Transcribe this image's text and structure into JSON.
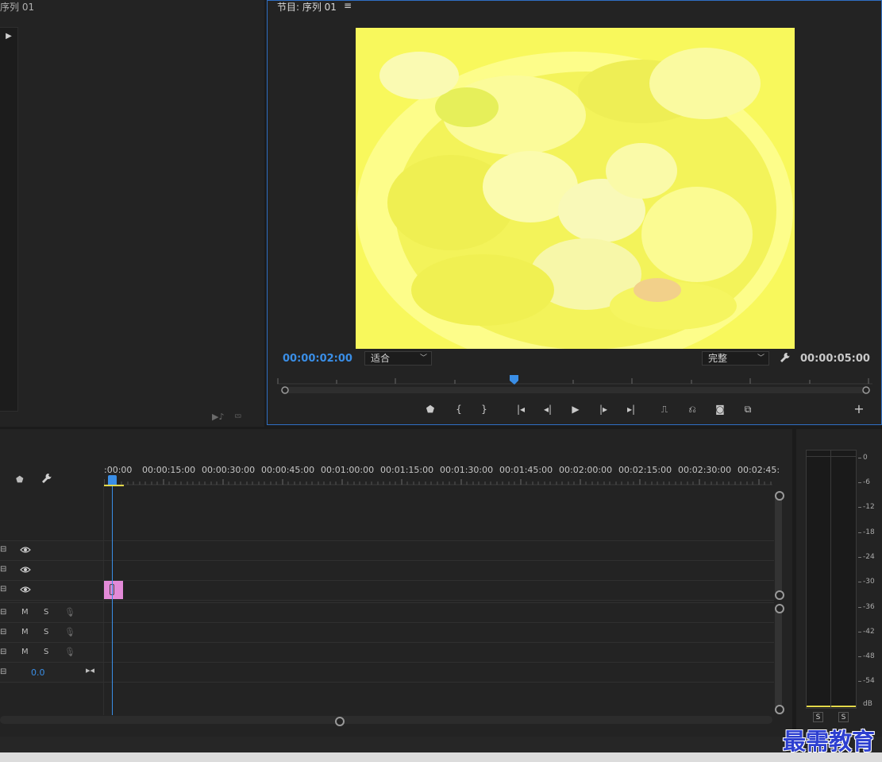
{
  "source_monitor": {
    "title": "序列 01"
  },
  "program_monitor": {
    "title": "节目: 序列 01",
    "menu_icon": "hamburger-icon",
    "current_timecode": "00:00:02:00",
    "fit_option": "适合",
    "quality_option": "完整",
    "duration_timecode": "00:00:05:00",
    "controls": [
      "add-marker-icon",
      "mark-in-icon",
      "mark-out-icon",
      "go-to-in-icon",
      "step-back-icon",
      "play-icon",
      "step-forward-icon",
      "go-to-out-icon",
      "lift-icon",
      "extract-icon",
      "export-frame-icon",
      "comparison-view-icon",
      "add-button-icon"
    ]
  },
  "timeline": {
    "ruler_ticks": [
      ":00:00",
      "00:00:15:00",
      "00:00:30:00",
      "00:00:45:00",
      "00:01:00:00",
      "00:01:15:00",
      "00:01:30:00",
      "00:01:45:00",
      "00:02:00:00",
      "00:02:15:00",
      "00:02:30:00",
      "00:02:45:"
    ],
    "audio_toggles": {
      "mute": "M",
      "solo": "S"
    },
    "master_value": "0.0"
  },
  "audio_meter": {
    "db_labels": [
      "0",
      "-6",
      "-12",
      "-18",
      "-24",
      "-30",
      "-36",
      "-42",
      "-48",
      "-54",
      "dB"
    ],
    "solo_left": "S",
    "solo_right": "S"
  },
  "watermark": "最需教育",
  "colors": {
    "accent": "#3a8ee6",
    "clip": "#e38ad8",
    "inout": "#e3d84a"
  }
}
